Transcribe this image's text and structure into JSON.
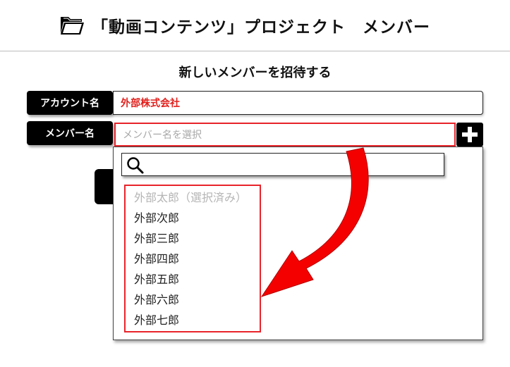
{
  "header": {
    "title": "「動画コンテンツ」プロジェクト　メンバー",
    "icon": "folder-icon"
  },
  "form": {
    "subtitle": "新しいメンバーを招待する",
    "account": {
      "label": "アカウント名",
      "value": "外部株式会社",
      "value_color": "#e0201c"
    },
    "member": {
      "label": "メンバー名",
      "placeholder": "メンバー名を選択",
      "add_icon": "plus-icon"
    }
  },
  "dropdown": {
    "search_icon": "search-icon",
    "search_value": "",
    "options": [
      {
        "label": "外部太郎（選択済み）",
        "selected": true
      },
      {
        "label": "外部次郎",
        "selected": false
      },
      {
        "label": "外部三郎",
        "selected": false
      },
      {
        "label": "外部四郎",
        "selected": false
      },
      {
        "label": "外部五郎",
        "selected": false
      },
      {
        "label": "外部六郎",
        "selected": false
      },
      {
        "label": "外部七郎",
        "selected": false
      }
    ]
  },
  "colors": {
    "accent_red": "#e8232a",
    "label_bg": "#000000"
  }
}
